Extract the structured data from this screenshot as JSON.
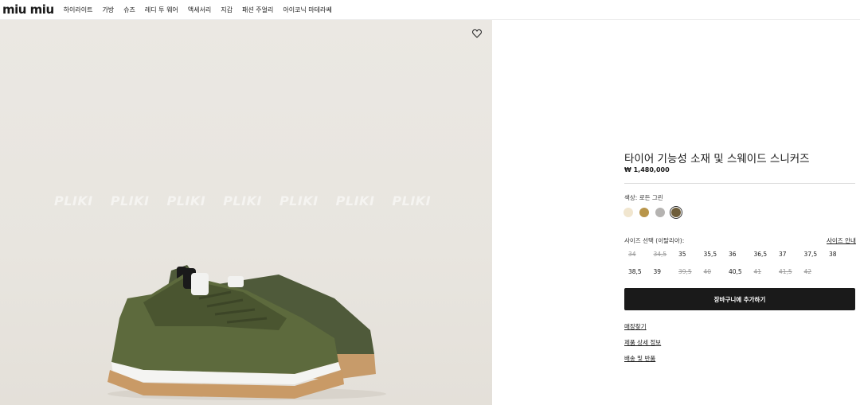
{
  "header": {
    "logo": "miu miu",
    "nav": [
      "하이라이트",
      "가방",
      "슈즈",
      "레디 투 웨어",
      "액세서리",
      "지갑",
      "패션 주얼리",
      "아이코닉 마테라쎄"
    ]
  },
  "hero": {
    "watermark": [
      "PLIKI",
      "PLIKI",
      "PLIKI",
      "PLIKI",
      "PLIKI",
      "PLIKI",
      "PLIKI"
    ],
    "wishlist_icon": "heart-outline-icon"
  },
  "product": {
    "title": "타이어 기능성 소재 및 스웨이드 스니커즈",
    "price": "₩ 1,480,000",
    "color_label": "색상:  로든 그린",
    "swatches": [
      {
        "color": "#f1e6cf",
        "selected": false
      },
      {
        "color": "#b8954a",
        "selected": false
      },
      {
        "color": "#b5b3b1",
        "selected": false
      },
      {
        "color": "#6e5d3a",
        "selected": true
      }
    ],
    "size_label": "사이즈 선택 (이탈리아):",
    "size_guide": "사이즈 안내",
    "sizes": [
      {
        "label": "34",
        "available": false
      },
      {
        "label": "34,5",
        "available": false
      },
      {
        "label": "35",
        "available": true
      },
      {
        "label": "35,5",
        "available": true
      },
      {
        "label": "36",
        "available": true
      },
      {
        "label": "36,5",
        "available": true
      },
      {
        "label": "37",
        "available": true
      },
      {
        "label": "37,5",
        "available": true
      },
      {
        "label": "38",
        "available": true
      },
      {
        "label": "38,5",
        "available": true
      },
      {
        "label": "39",
        "available": true
      },
      {
        "label": "39,5",
        "available": false
      },
      {
        "label": "40",
        "available": false
      },
      {
        "label": "40,5",
        "available": true
      },
      {
        "label": "41",
        "available": false
      },
      {
        "label": "41,5",
        "available": false
      },
      {
        "label": "42",
        "available": false
      }
    ],
    "cart_button": "장바구니에 추가하기",
    "links": [
      "매장찾기",
      "제품 상세 정보",
      "배송 및 반품"
    ]
  }
}
